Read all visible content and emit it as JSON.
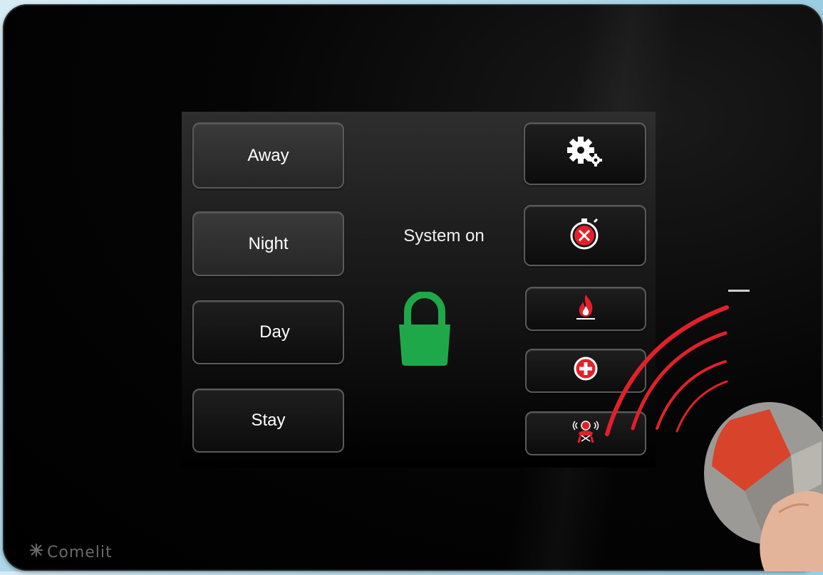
{
  "modes": {
    "away_label": "Away",
    "night_label": "Night",
    "day_label": "Day",
    "stay_label": "Stay"
  },
  "status": {
    "text": "System on",
    "lock_state": "locked",
    "lock_color": "#1fa84a"
  },
  "actions": [
    {
      "name": "settings-button",
      "icon": "gear-icon"
    },
    {
      "name": "timer-cancel-button",
      "icon": "stopwatch-cancel-icon"
    },
    {
      "name": "fire-alarm-button",
      "icon": "fire-icon"
    },
    {
      "name": "medical-alarm-button",
      "icon": "medical-cross-icon"
    },
    {
      "name": "panic-alarm-button",
      "icon": "panic-siren-icon"
    }
  ],
  "brand": {
    "logo_text": "Comelit"
  },
  "colors": {
    "alarm_red": "#e3202a",
    "screen_dark": "#1d1d1d",
    "accent_green": "#1fa84a"
  }
}
